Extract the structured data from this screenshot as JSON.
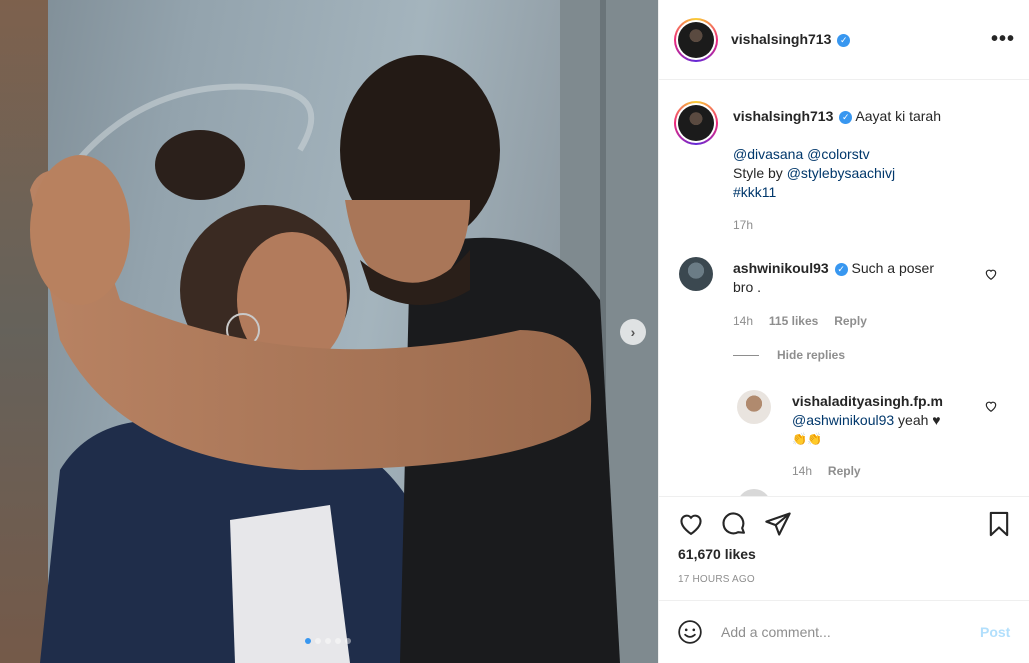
{
  "header": {
    "username": "vishalsingh713",
    "verified_icon": "verified-badge-icon",
    "more_icon": "more-options-icon"
  },
  "caption": {
    "username": "vishalsingh713",
    "text": "Aayat ki tarah",
    "mention1": "@divasana",
    "mention2": "@colorstv",
    "style_prefix": "Style by",
    "style_mention": "@stylebysaachivj",
    "hashtag": "#kkk11",
    "time": "17h"
  },
  "comments": [
    {
      "username": "ashwinikoul93",
      "text_line1": "Such a poser",
      "text_line2": "bro .",
      "time": "14h",
      "likes": "115 likes",
      "reply_label": "Reply",
      "hide_replies": "Hide replies"
    }
  ],
  "replies": [
    {
      "username": "vishaladityasingh.fp.m",
      "mention": "@ashwinikoul93",
      "text": "yeah",
      "emoji_line1": "♥",
      "emoji_line2": "👏👏",
      "time": "14h",
      "reply_label": "Reply"
    }
  ],
  "actions": {
    "likes": "61,670 likes",
    "posted_ago": "17 HOURS AGO"
  },
  "composer": {
    "placeholder": "Add a comment...",
    "post_label": "Post"
  },
  "carousel": {
    "slide_count": 5,
    "active_index": 0
  },
  "colors": {
    "accent": "#3897f0",
    "link": "#00376b",
    "muted": "#8e8e8e",
    "post_disabled": "#b2dffc"
  }
}
